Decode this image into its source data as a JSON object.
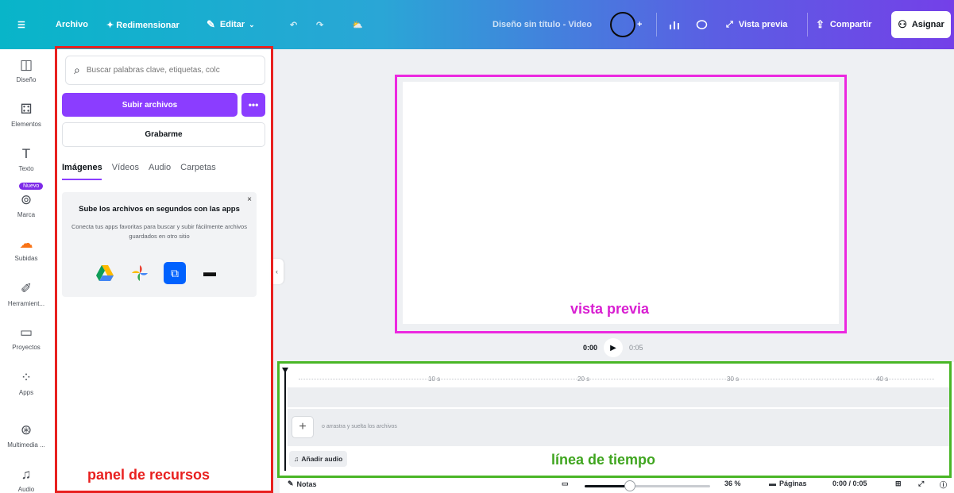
{
  "topbar": {
    "menu_icon": "menu-icon",
    "archivo": "Archivo",
    "redimensionar": "✦ Redimensionar",
    "editar": "Editar",
    "design_title": "Diseño sin título - Video",
    "vista_previa": "Vista previa",
    "compartir": "Compartir",
    "asignar": "Asignar"
  },
  "rail": {
    "items": [
      {
        "label": "Diseño",
        "icon": "layout-icon"
      },
      {
        "label": "Elementos",
        "icon": "shapes-icon"
      },
      {
        "label": "Texto",
        "icon": "text-icon"
      },
      {
        "label": "Marca",
        "icon": "brand-icon"
      },
      {
        "label": "Subidas",
        "icon": "upload-cloud-icon"
      },
      {
        "label": "Herramient...",
        "icon": "tools-icon"
      },
      {
        "label": "Proyectos",
        "icon": "folder-icon"
      },
      {
        "label": "Apps",
        "icon": "apps-icon"
      },
      {
        "label": "Multimedia ...",
        "icon": "media-icon"
      },
      {
        "label": "Audio",
        "icon": "music-icon"
      }
    ],
    "badge": "Nuevo"
  },
  "panel": {
    "search_placeholder": "Buscar palabras clave, etiquetas, colc",
    "upload_label": "Subir archivos",
    "more_label": "•••",
    "record_label": "Grabarme",
    "tabs": [
      "Imágenes",
      "Vídeos",
      "Audio",
      "Carpetas"
    ],
    "card": {
      "title": "Sube los archivos en segundos con las apps",
      "description": "Conecta tus apps favoritas para buscar y subir fácilmente archivos guardados en otro sitio",
      "close": "×"
    },
    "annotation": "panel de recursos"
  },
  "canvas": {
    "annotation": "vista previa",
    "time_current": "0:00",
    "time_total": "0:05"
  },
  "timeline": {
    "ticks": [
      "10 s",
      "20 s",
      "30 s",
      "40 s"
    ],
    "drop_text": "o arrastra y suelta los archivos",
    "add_audio": "Añadir audio",
    "annotation": "línea de tiempo"
  },
  "bottombar": {
    "notes": "Notas",
    "zoom": "36 %",
    "zoom_fraction": 0.36,
    "pages": "Páginas",
    "time": "0:00 / 0:05"
  },
  "colors": {
    "accent": "#8b3dff",
    "panel_frame": "#e8201f",
    "preview_frame": "#ec28e0",
    "timeline_frame": "#49b626"
  }
}
